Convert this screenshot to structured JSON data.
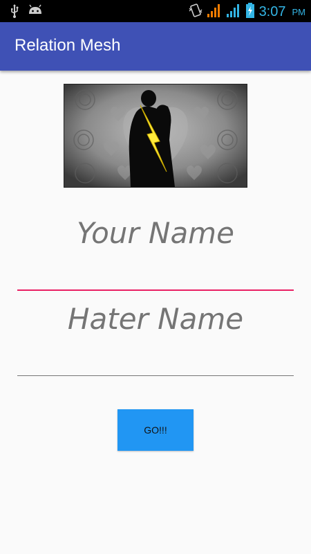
{
  "status_bar": {
    "time": "3:07",
    "ampm": "PM",
    "icons": [
      "usb-icon",
      "android-icon",
      "vibrate-icon",
      "signal-icon",
      "signal-icon",
      "battery-charging-icon"
    ],
    "colors": {
      "time": "#33b5e5",
      "signal_orange": "#f57c00",
      "signal_blue": "#33b5e5"
    }
  },
  "app_bar": {
    "title": "Relation Mesh",
    "color": "#3f51b5"
  },
  "hero_image": {
    "description_icon": "couple-lightning-image"
  },
  "form": {
    "your_name": {
      "label": "Your Name",
      "value": "",
      "underline_color": "#e91e63"
    },
    "hater_name": {
      "label": "Hater Name",
      "value": "",
      "underline_color": "#757575"
    }
  },
  "go_button": {
    "label": "GO!!!",
    "color": "#2196f3"
  }
}
